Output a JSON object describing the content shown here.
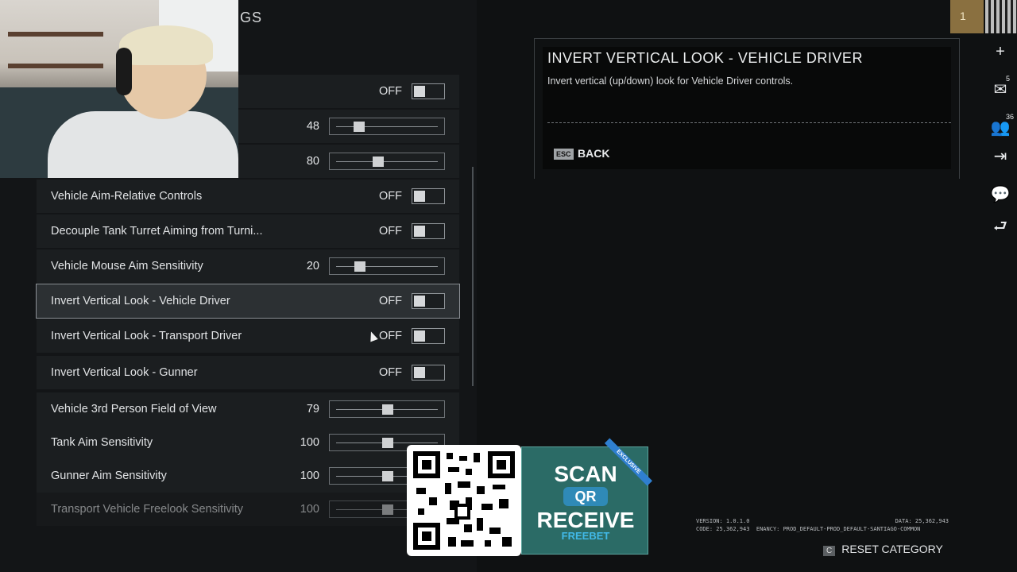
{
  "page": {
    "title": "GS"
  },
  "settings": [
    {
      "label": "",
      "type": "toggle",
      "value": "OFF"
    },
    {
      "label": "",
      "type": "slider",
      "value": "48",
      "fraction": 0.22
    },
    {
      "label": "",
      "type": "slider",
      "value": "80",
      "fraction": 0.41
    },
    {
      "label": "Vehicle Aim-Relative Controls",
      "type": "toggle",
      "value": "OFF"
    },
    {
      "label": "Decouple Tank Turret Aiming from Turni...",
      "type": "toggle",
      "value": "OFF"
    },
    {
      "label": "Vehicle Mouse Aim Sensitivity",
      "type": "slider",
      "value": "20",
      "fraction": 0.23
    },
    {
      "label": "Invert Vertical Look - Vehicle Driver",
      "type": "toggle",
      "value": "OFF",
      "selected": true
    },
    {
      "label": "Invert Vertical Look - Transport Driver",
      "type": "toggle",
      "value": "OFF"
    },
    {
      "label": "Invert Vertical Look - Gunner",
      "type": "toggle",
      "value": "OFF"
    },
    {
      "label": "Vehicle 3rd Person Field of View",
      "type": "slider",
      "value": "79",
      "fraction": 0.5
    },
    {
      "label": "Tank Aim Sensitivity",
      "type": "slider",
      "value": "100",
      "fraction": 0.5
    },
    {
      "label": "Gunner Aim Sensitivity",
      "type": "slider",
      "value": "100",
      "fraction": 0.5
    },
    {
      "label": "Transport Vehicle Freelook Sensitivity",
      "type": "slider",
      "value": "100",
      "fraction": 0.5
    }
  ],
  "description": {
    "title": "INVERT VERTICAL LOOK - VEHICLE DRIVER",
    "body": "Invert vertical (up/down) look for Vehicle Driver controls.",
    "esc_key": "ESC",
    "back_label": "BACK"
  },
  "sidebar": {
    "rank": "1",
    "icons": [
      {
        "name": "plus-icon",
        "glyph": "+"
      },
      {
        "name": "mail-icon",
        "glyph": "✉",
        "count": "5"
      },
      {
        "name": "friends-icon",
        "glyph": "👥",
        "count": "36"
      },
      {
        "name": "exit-icon",
        "glyph": "⇥"
      },
      {
        "name": "chat-icon",
        "glyph": "💬"
      },
      {
        "name": "feedback-icon",
        "glyph": "⮐"
      }
    ]
  },
  "footer": {
    "version": "VERSION: 1.0.1.0",
    "code": "CODE: 25,362,943",
    "data": "DATA: 25,362,943",
    "tenancy": "ENANCY: PROD_DEFAULT-PROD_DEFAULT-SANTIAGO-COMMON",
    "reset_key": "C",
    "reset_label": "RESET CATEGORY"
  },
  "ad": {
    "scan": "SCAN",
    "qr": "QR",
    "receive": "RECEIVE",
    "freebet": "FREEBET",
    "exclusive": "EXCLUSIVE"
  },
  "colors": {
    "selected_row": "#2c3033",
    "ad_teal": "#2b6b66",
    "ad_blue": "#2f8ab7"
  }
}
